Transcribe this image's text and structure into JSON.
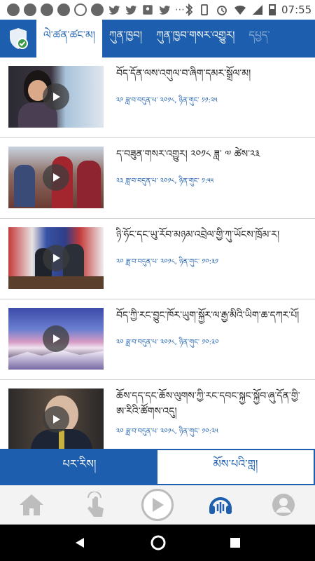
{
  "status_bar": {
    "time": "07:55"
  },
  "header": {
    "tabs": [
      {
        "label": "ལེ་ཚན་ཚང་མ།",
        "active": true
      },
      {
        "label": "ཀུན་ཁྱབ།",
        "active": false
      },
      {
        "label": "ཀུན་ཁྱབ་གསར་འགྱུར།",
        "active": false
      },
      {
        "label": "དཔྱད་",
        "active": false
      }
    ]
  },
  "videos": [
    {
      "title": "བོད་དོན་ལས་འགུལ་བ་ཞིག་དམར་སྒྲོལ་མ།",
      "date": "༢༩ ཟླ་བ་བདུན་པ་ ༢༠༡༨, ཉིན་གུང་ ༡༡:༢༥"
    },
    {
      "title": "ད་བཟུན་གསར་འགྱུར། ༢༠༡༨ ཟླ་ ༧ ཚེས་༢༣",
      "date": "༢༣ ཟླ་བ་བདུན་པ་ ༢༠༡༨, ཉིན་གུང་ ༡:༥༥"
    },
    {
      "title": "ཉི་ཧོང་དང་ཡུ་རོབ་མཉམ་འབྲེལ་གྱི་ཀུ་ཡོངས་ཁྲོམ་ར།",
      "date": "༢༠ ཟླ་བ་བདུན་པ་ ༢༠༡༨, ཉིན་གུང་ ༡༠:༣༡"
    },
    {
      "title": "བོད་ཀྱི་རང་བྱུང་ཁོར་ཡུག་སྐྱོར་ལ་རྒྱ་མིའི་ཡིག་ཆ་དཀར་པོ།",
      "date": "༢༠ ཟླ་བ་བདུན་པ་ ༢༠༡༨, ཉིན་གུང་ ༡༠:༣༠"
    },
    {
      "title": "ཆོས་དད་དང་ཆོས་ལུགས་ཀྱི་རང་དབང་སྐྱང་སྐྱོབ་ཞུ་དོན་གྱི་ཨ་རིའི་ཚོགས་འདུ།",
      "date": "༢༠ ཟླ་བ་བདུན་པ་ ༢༠༡༨, ཉིན་གུང་ ༡༠:༢༥"
    }
  ],
  "segment": {
    "left_label": "པར་རིས།",
    "right_label": "མོས་པའི་གླ།"
  },
  "colors": {
    "brand": "#1d5fae"
  }
}
